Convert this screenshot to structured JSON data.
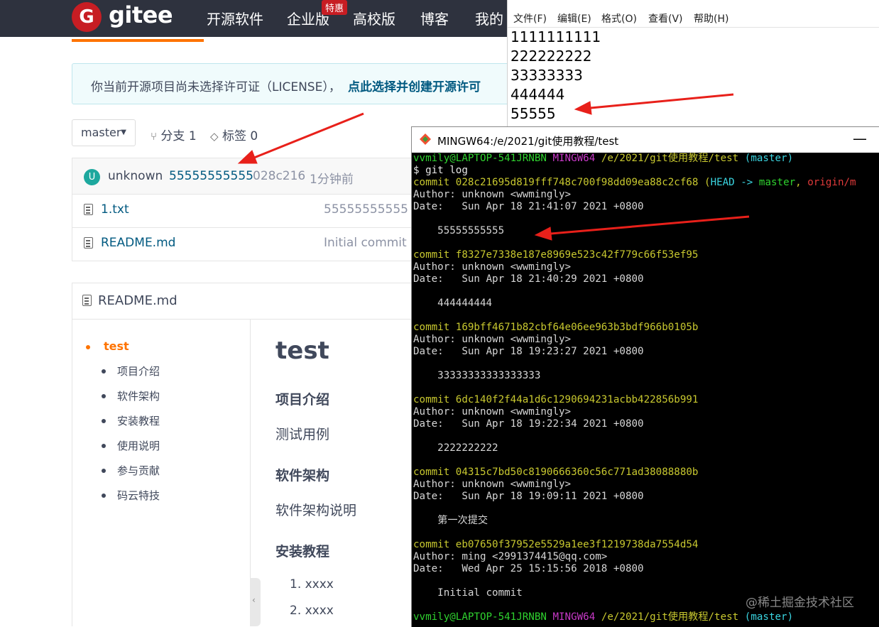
{
  "gitee": {
    "logo_letter": "G",
    "logo_text": "gitee",
    "nav": [
      "开源软件",
      "企业版",
      "高校版",
      "博客",
      "我的"
    ],
    "badge": "特惠",
    "notice_text": "你当前开源项目尚未选择许可证（LICENSE），",
    "notice_link": "点此选择并创建开源许可",
    "branch": "master",
    "branch_count": "分支 1",
    "tag_count": "标签 0",
    "commit": {
      "avatar_letter": "U",
      "author": "unknown",
      "message": "55555555555",
      "hash": "028c216",
      "time": "1分钟前"
    },
    "files": [
      {
        "name": "1.txt",
        "message": "55555555555"
      },
      {
        "name": "README.md",
        "message": "Initial commit"
      }
    ],
    "readme": {
      "header": "README.md",
      "toc_top": "test",
      "toc": [
        "项目介绍",
        "软件架构",
        "安装教程",
        "使用说明",
        "参与贡献",
        "码云特技"
      ],
      "h1": "test",
      "h2_intro": "项目介绍",
      "p_intro": "测试用例",
      "h2_arch": "软件架构",
      "p_arch": "软件架构说明",
      "h2_install": "安装教程",
      "list": [
        "1. xxxx",
        "2. xxxx"
      ],
      "collapse": "‹"
    }
  },
  "notepad": {
    "menu": [
      "文件(F)",
      "编辑(E)",
      "格式(O)",
      "查看(V)",
      "帮助(H)"
    ],
    "lines": [
      "1111111111",
      "222222222",
      "33333333",
      "444444",
      "55555"
    ]
  },
  "terminal": {
    "title": "MINGW64:/e/2021/git使用教程/test",
    "minimize": "—",
    "prompt_user": "vvmily@LAPTOP-541JRNBN",
    "prompt_env": "MINGW64",
    "prompt_path": "/e/2021/git使用教程/test",
    "prompt_branch": "(master)",
    "command": "$ git log",
    "commits": [
      {
        "commit": "commit 028c21695d819fff748c700f98dd09ea88c2cf68",
        "refs_open": " (",
        "head": "HEAD -> ",
        "master": "master",
        "comma": ", ",
        "origin": "origin/m",
        "author": "Author: unknown <wwmingly>",
        "date": "Date:   Sun Apr 18 21:41:07 2021 +0800",
        "msg": "    55555555555"
      },
      {
        "commit": "commit f8327e7338e187e8969e523c42f779c66f53ef95",
        "author": "Author: unknown <wwmingly>",
        "date": "Date:   Sun Apr 18 21:40:29 2021 +0800",
        "msg": "    444444444"
      },
      {
        "commit": "commit 169bff4671b82cbf64e06ee963b3bdf966b0105b",
        "author": "Author: unknown <wwmingly>",
        "date": "Date:   Sun Apr 18 19:23:27 2021 +0800",
        "msg": "    33333333333333333"
      },
      {
        "commit": "commit 6dc140f2f44a1d6c1290694231acbb422856b991",
        "author": "Author: unknown <wwmingly>",
        "date": "Date:   Sun Apr 18 19:22:34 2021 +0800",
        "msg": "    2222222222"
      },
      {
        "commit": "commit 04315c7bd50c8190666360c56c771ad38088880b",
        "author": "Author: unknown <wwmingly>",
        "date": "Date:   Sun Apr 18 19:09:11 2021 +0800",
        "msg": "    第一次提交"
      },
      {
        "commit": "commit eb07650f37952e5529a1ee3f1219738da7554d54",
        "author": "Author: ming <2991374415@qq.com>",
        "date": "Date:   Wed Apr 25 15:15:56 2018 +0800",
        "msg": "    Initial commit"
      }
    ]
  },
  "watermark": "@稀土掘金技术社区",
  "colors": {
    "brand": "#c71d23",
    "accent": "#fe7300",
    "link": "#005980",
    "arrow": "#e8201a"
  }
}
